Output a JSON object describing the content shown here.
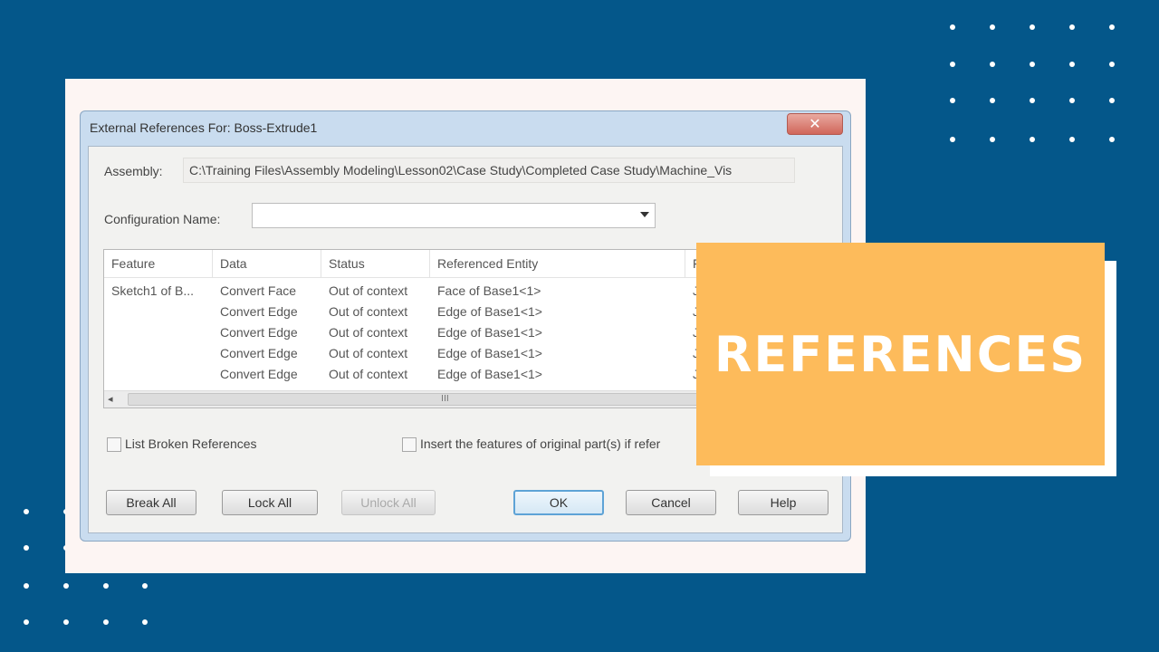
{
  "colors": {
    "background": "#04578a",
    "accent": "#fdbb5b",
    "panel": "#fdf5f3"
  },
  "dialog": {
    "title": "External References For: Boss-Extrude1",
    "close_glyph": "✕",
    "assembly_label": "Assembly:",
    "assembly_path": "C:\\Training Files\\Assembly Modeling\\Lesson02\\Case Study\\Completed Case Study\\Machine_Vis",
    "config_label": "Configuration Name:",
    "config_value": "",
    "table": {
      "headers": [
        "Feature",
        "Data",
        "Status",
        "Referenced Entity",
        "F"
      ],
      "rows": [
        [
          "Sketch1  of  B...",
          "Convert Face",
          "Out of context",
          "Face of Base1<1>",
          "J"
        ],
        [
          "",
          "Convert Edge",
          "Out of context",
          "Edge of Base1<1>",
          "J"
        ],
        [
          "",
          "Convert Edge",
          "Out of context",
          "Edge of Base1<1>",
          "J"
        ],
        [
          "",
          "Convert Edge",
          "Out of context",
          "Edge of Base1<1>",
          "J"
        ],
        [
          "",
          "Convert Edge",
          "Out of context",
          "Edge of Base1<1>",
          "J"
        ]
      ],
      "scroll_left": "◂",
      "scroll_grip": "III"
    },
    "list_broken_label": "List Broken References",
    "insert_features_label": "Insert the features of original part(s) if refer",
    "buttons": {
      "break_all": "Break All",
      "lock_all": "Lock All",
      "unlock_all": "Unlock All",
      "ok": "OK",
      "cancel": "Cancel",
      "help": "Help"
    }
  },
  "banner": {
    "text": "REFERENCES"
  }
}
